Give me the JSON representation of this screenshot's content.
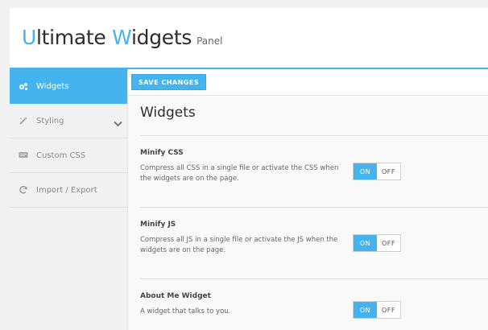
{
  "header": {
    "title_parts": [
      "U",
      "ltimate ",
      "W",
      "idgets"
    ],
    "subtitle": "Panel",
    "accent_color": "#44b3ee"
  },
  "sidebar": {
    "items": [
      {
        "label": "Widgets",
        "icon": "gears-icon",
        "active": true
      },
      {
        "label": "Styling",
        "icon": "magic-wand-icon",
        "has_submenu": true
      },
      {
        "label": "Custom CSS",
        "icon": "css-icon"
      },
      {
        "label": "Import / Export",
        "icon": "refresh-icon"
      }
    ]
  },
  "toolbar": {
    "save_label": "SAVE CHANGES"
  },
  "main": {
    "title": "Widgets",
    "settings": [
      {
        "name": "Minify CSS",
        "description": "Compress all CSS in a single file or activate the CSS when the widgets are on the page.",
        "on_label": "ON",
        "off_label": "OFF",
        "value": "ON"
      },
      {
        "name": "Minify JS",
        "description": "Compress all JS in a single file or activate the JS when the widgets are on the page.",
        "on_label": "ON",
        "off_label": "OFF",
        "value": "ON"
      },
      {
        "name": "About Me Widget",
        "description": "A widget that talks to you.",
        "on_label": "ON",
        "off_label": "OFF",
        "value": "ON"
      }
    ]
  }
}
